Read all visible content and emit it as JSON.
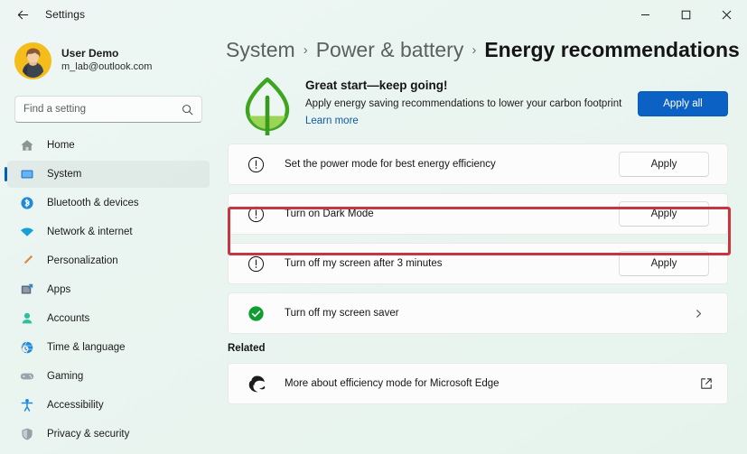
{
  "window": {
    "title": "Settings",
    "back_icon": "arrow-left-icon",
    "minimize_label": "Minimize",
    "maximize_label": "Maximize",
    "close_label": "Close"
  },
  "sidebar": {
    "profile": {
      "name": "User Demo",
      "email": "m_lab@outlook.com"
    },
    "search": {
      "placeholder": "Find a setting",
      "value": "",
      "icon": "search-icon"
    },
    "items": [
      {
        "label": "Home",
        "icon": "home-icon",
        "selected": false
      },
      {
        "label": "System",
        "icon": "monitor-icon",
        "selected": true
      },
      {
        "label": "Bluetooth & devices",
        "icon": "bluetooth-icon",
        "selected": false
      },
      {
        "label": "Network & internet",
        "icon": "wifi-icon",
        "selected": false
      },
      {
        "label": "Personalization",
        "icon": "paintbrush-icon",
        "selected": false
      },
      {
        "label": "Apps",
        "icon": "apps-icon",
        "selected": false
      },
      {
        "label": "Accounts",
        "icon": "person-icon",
        "selected": false
      },
      {
        "label": "Time & language",
        "icon": "globe-clock-icon",
        "selected": false
      },
      {
        "label": "Gaming",
        "icon": "gamepad-icon",
        "selected": false
      },
      {
        "label": "Accessibility",
        "icon": "accessibility-icon",
        "selected": false
      },
      {
        "label": "Privacy & security",
        "icon": "shield-icon",
        "selected": false
      }
    ]
  },
  "breadcrumb": {
    "items": [
      "System",
      "Power & battery",
      "Energy recommendations"
    ],
    "separator": "›"
  },
  "banner": {
    "icon": "leaf-icon",
    "title": "Great start—keep going!",
    "subtitle": "Apply energy saving recommendations to lower your carbon footprint",
    "link": "Learn more",
    "apply_all_label": "Apply all"
  },
  "recommendations": [
    {
      "label": "Set the power mode for best energy efficiency",
      "status_icon": "exclamation-circle-icon",
      "action": "button",
      "action_label": "Apply",
      "highlighted": false
    },
    {
      "label": "Turn on Dark Mode",
      "status_icon": "exclamation-circle-icon",
      "action": "button",
      "action_label": "Apply",
      "highlighted": true
    },
    {
      "label": "Turn off my screen after 3 minutes",
      "status_icon": "exclamation-circle-icon",
      "action": "button",
      "action_label": "Apply",
      "highlighted": false
    },
    {
      "label": "Turn off my screen saver",
      "status_icon": "check-circle-icon",
      "action": "chevron",
      "action_label": "›",
      "highlighted": false
    }
  ],
  "related": {
    "heading": "Related",
    "link_label": "More about efficiency mode for Microsoft Edge",
    "link_icon": "edge-icon",
    "external_icon": "open-in-new-icon"
  },
  "colors": {
    "accent": "#0b62c4",
    "highlight": "#c9353f",
    "leaf_green": "#3ea520",
    "success_green": "#0f9d2f",
    "link_blue": "#0d5ba6",
    "background": "#e9f4ef"
  }
}
